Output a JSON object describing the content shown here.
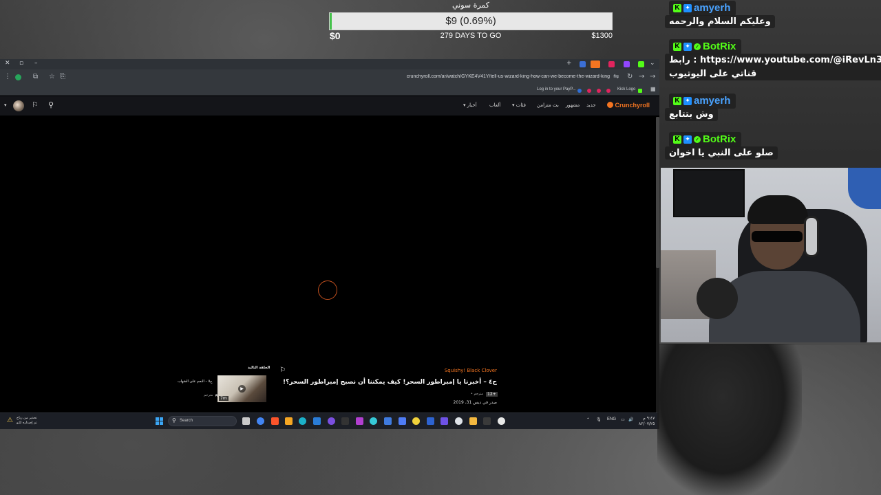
{
  "goal": {
    "title": "كمرة سوني",
    "amount": "$9 (0.69%)",
    "progress_percent": 0.69,
    "start": "$0",
    "days_to_go": "279 DAYS TO GO",
    "end": "$1300",
    "fill_color": "#45c24b"
  },
  "browser": {
    "url": "crunchyroll.com/ar/watch/GYKE4V41Y/tell-us-wizard-king-how-can-we-become-the-wizard-king",
    "bookmarks": {
      "paypal": "Log in to your PayP...",
      "kick_logo": "Kick Logo"
    }
  },
  "crunchyroll": {
    "logo": "Crunchyroll",
    "nav": {
      "new": "جديد",
      "popular": "مشهور",
      "simulcast": "بث متزامن",
      "categories": "فئات",
      "games": "ألعاب",
      "news": "أخبار"
    },
    "brand_color": "#f47521"
  },
  "episode": {
    "series": "Squishy! Black Clover",
    "title": "ح٤ – أخبرنا يا إمبراطور السحر! كيف يمكننا أن نصبح إمبراطور السحر؟!",
    "rating": "12+",
    "subtitle_info": "• مترجم",
    "release_date": "صدر في ديس 31، 2019",
    "next": {
      "label": "الحلقة التالية",
      "title": "ح٥ – النجم على الشهاب",
      "sub": "مترجم",
      "duration": "7m"
    }
  },
  "taskbar": {
    "warning_line1": "تحذير من رياح",
    "warning_line2": "تم إصداره للتو",
    "search_placeholder": "Search",
    "language": "ENG",
    "time": "٩:٤٧ م",
    "date": "٨٢/٠٧/٢٥"
  },
  "chat": {
    "messages": [
      {
        "username": "amyerh",
        "username_color": "#4aa3ff",
        "badges": [
          "kick",
          "blue"
        ],
        "text": "وعليكم السلام والرحمه"
      },
      {
        "username": "BotRix",
        "username_color": "#53fc18",
        "badges": [
          "kick",
          "blue",
          "verified"
        ],
        "text": "رابط : https://www.youtube.com/@iRevLn388",
        "text2": "قناتي على اليوتيوب"
      },
      {
        "username": "amyerh",
        "username_color": "#4aa3ff",
        "badges": [
          "kick",
          "blue"
        ],
        "text": "وش بتتابع"
      },
      {
        "username": "BotRix",
        "username_color": "#53fc18",
        "badges": [
          "kick",
          "blue",
          "verified"
        ],
        "text": "صلو على النبي يا اخوان"
      }
    ]
  }
}
